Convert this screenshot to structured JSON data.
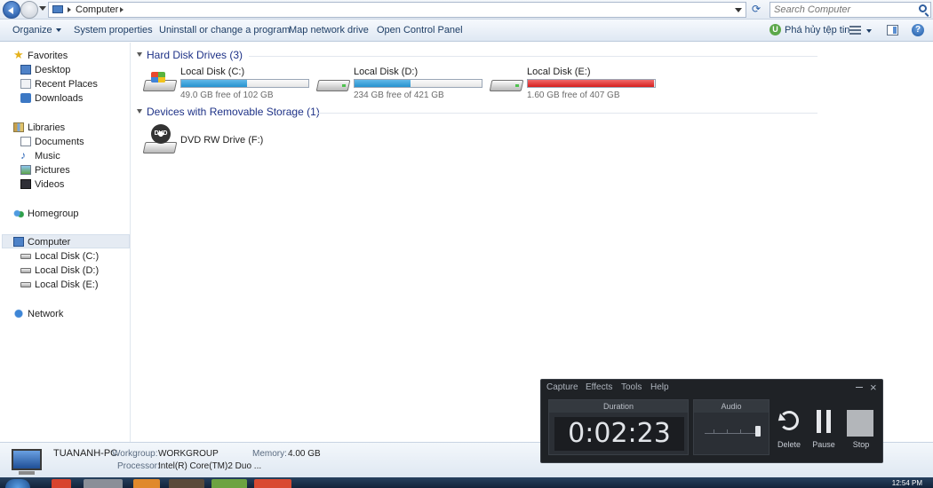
{
  "address": {
    "location": "Computer",
    "search_placeholder": "Search Computer"
  },
  "toolbar": {
    "organize": "Organize",
    "system_properties": "System properties",
    "uninstall": "Uninstall or change a program",
    "map_drive": "Map network drive",
    "control_panel": "Open Control Panel",
    "uninstall_tool": "Phá hủy tệp tin"
  },
  "nav": {
    "favorites": "Favorites",
    "desktop": "Desktop",
    "recent": "Recent Places",
    "downloads": "Downloads",
    "libraries": "Libraries",
    "documents": "Documents",
    "music": "Music",
    "pictures": "Pictures",
    "videos": "Videos",
    "homegroup": "Homegroup",
    "computer": "Computer",
    "disk_c": "Local Disk (C:)",
    "disk_d": "Local Disk (D:)",
    "disk_e": "Local Disk (E:)",
    "network": "Network"
  },
  "groups": {
    "hdd": "Hard Disk Drives (3)",
    "removable": "Devices with Removable Storage (1)"
  },
  "drives": [
    {
      "name": "Local Disk (C:)",
      "free": "49.0 GB free of 102 GB",
      "used_pct": 52,
      "bar_color": "#2693cf"
    },
    {
      "name": "Local Disk (D:)",
      "free": "234 GB free of 421 GB",
      "used_pct": 44,
      "bar_color": "#2693cf"
    },
    {
      "name": "Local Disk (E:)",
      "free": "1.60 GB free of 407 GB",
      "used_pct": 99.6,
      "bar_color": "#d51f1f"
    }
  ],
  "dvd": {
    "name": "DVD RW Drive (F:)",
    "badge": "DVD"
  },
  "details": {
    "pc_name": "TUANANH-PC",
    "workgroup_label": "Workgroup:",
    "workgroup": "WORKGROUP",
    "memory_label": "Memory:",
    "memory": "4.00 GB",
    "processor_label": "Processor:",
    "processor": "Intel(R) Core(TM)2 Duo ..."
  },
  "recorder": {
    "menu": [
      "Capture",
      "Effects",
      "Tools",
      "Help"
    ],
    "duration_label": "Duration",
    "duration": "0:02:23",
    "audio_label": "Audio",
    "delete": "Delete",
    "pause": "Pause",
    "stop": "Stop"
  },
  "taskbar": {
    "clock": "12:54 PM"
  }
}
